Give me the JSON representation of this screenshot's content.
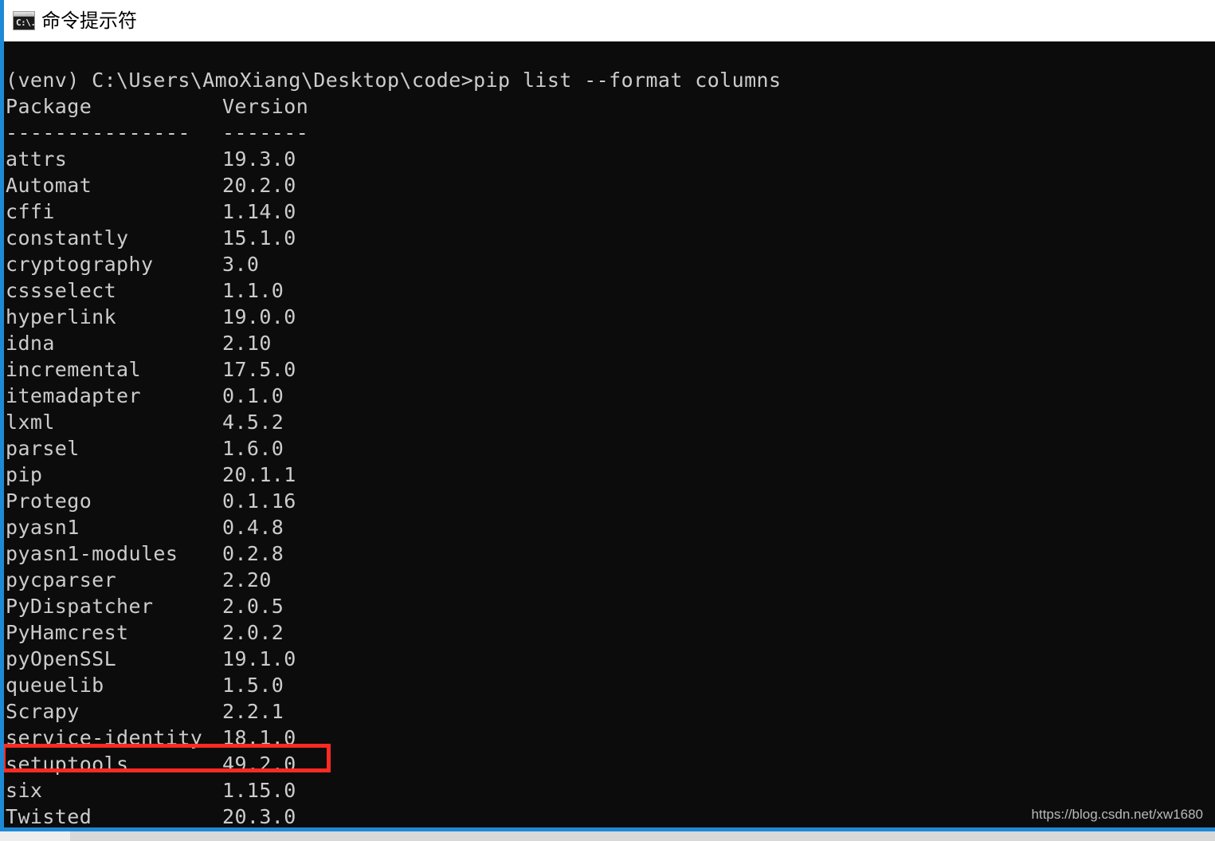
{
  "window": {
    "title": "命令提示符",
    "icon": "cmd-icon",
    "icon_glyph": "C:\\.",
    "accent_color": "#1e8ad6",
    "titlebar_background": "#ffffff",
    "terminal_background": "#0c0c0c",
    "terminal_foreground": "#cccccc"
  },
  "terminal": {
    "prompt_line": "(venv) C:\\Users\\AmoXiang\\Desktop\\code>pip list --format columns",
    "header": {
      "package": "Package",
      "version": "Version"
    },
    "separator": {
      "package": "---------------",
      "version": "-------"
    },
    "rows": [
      {
        "package": "attrs",
        "version": "19.3.0"
      },
      {
        "package": "Automat",
        "version": "20.2.0"
      },
      {
        "package": "cffi",
        "version": "1.14.0"
      },
      {
        "package": "constantly",
        "version": "15.1.0"
      },
      {
        "package": "cryptography",
        "version": "3.0"
      },
      {
        "package": "cssselect",
        "version": "1.1.0"
      },
      {
        "package": "hyperlink",
        "version": "19.0.0"
      },
      {
        "package": "idna",
        "version": "2.10"
      },
      {
        "package": "incremental",
        "version": "17.5.0"
      },
      {
        "package": "itemadapter",
        "version": "0.1.0"
      },
      {
        "package": "lxml",
        "version": "4.5.2"
      },
      {
        "package": "parsel",
        "version": "1.6.0"
      },
      {
        "package": "pip",
        "version": "20.1.1"
      },
      {
        "package": "Protego",
        "version": "0.1.16"
      },
      {
        "package": "pyasn1",
        "version": "0.4.8"
      },
      {
        "package": "pyasn1-modules",
        "version": "0.2.8"
      },
      {
        "package": "pycparser",
        "version": "2.20"
      },
      {
        "package": "PyDispatcher",
        "version": "2.0.5"
      },
      {
        "package": "PyHamcrest",
        "version": "2.0.2"
      },
      {
        "package": "pyOpenSSL",
        "version": "19.1.0"
      },
      {
        "package": "queuelib",
        "version": "1.5.0"
      },
      {
        "package": "Scrapy",
        "version": "2.2.1"
      },
      {
        "package": "service-identity",
        "version": "18.1.0"
      },
      {
        "package": "setuptools",
        "version": "49.2.0"
      },
      {
        "package": "six",
        "version": "1.15.0"
      },
      {
        "package": "Twisted",
        "version": "20.3.0"
      }
    ]
  },
  "annotation": {
    "highlighted_row_index": 21,
    "highlighted_package": "Scrapy",
    "highlighted_version": "2.2.1",
    "color": "#fc2b22"
  },
  "watermark": {
    "text": "https://blog.csdn.net/xw1680"
  }
}
